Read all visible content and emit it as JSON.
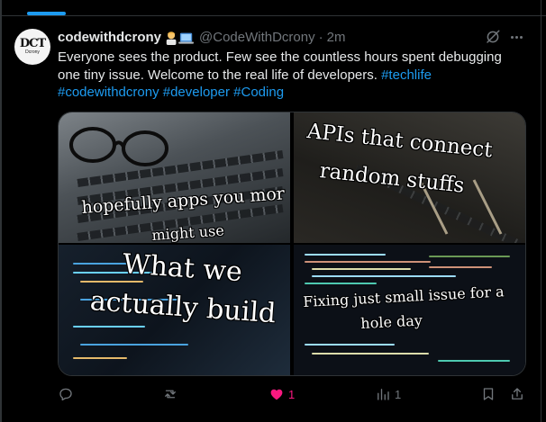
{
  "tweet": {
    "display_name": "codewithdcrony",
    "handle": "@CodeWithDcrony",
    "separator": "·",
    "time": "2m",
    "avatar": {
      "monogram": "DCT",
      "subtext": "Dcrony"
    },
    "text": "Everyone sees the product. Few see the countless hours spent debugging one tiny issue. Welcome to the real life of developers.",
    "hashtags": [
      "#techlife",
      "#codewithdcrony",
      "#developer",
      "#Coding"
    ]
  },
  "media": {
    "tiles": [
      {
        "caption_line1": "hopefully apps you mor",
        "caption_line2": "might use"
      },
      {
        "caption_line1": "APIs that connect",
        "caption_line2": "random stuffs"
      },
      {
        "caption_line1": "What we",
        "caption_line2": "actually build"
      },
      {
        "caption_line1": "Fixing just small issue for a",
        "caption_line2": "hole day"
      }
    ]
  },
  "actions": {
    "reply": {
      "icon": "reply-icon",
      "count": ""
    },
    "repost": {
      "icon": "repost-icon",
      "count": ""
    },
    "like": {
      "icon": "heart-icon",
      "count": "1",
      "active": true
    },
    "views": {
      "icon": "views-icon",
      "count": "1"
    },
    "bookmark": {
      "icon": "bookmark-icon"
    },
    "share": {
      "icon": "share-icon"
    }
  },
  "colors": {
    "background": "#000000",
    "text": "#e7e9ea",
    "muted": "#71767b",
    "link": "#1d9bf0",
    "like": "#f91880",
    "border": "#2f3336"
  }
}
